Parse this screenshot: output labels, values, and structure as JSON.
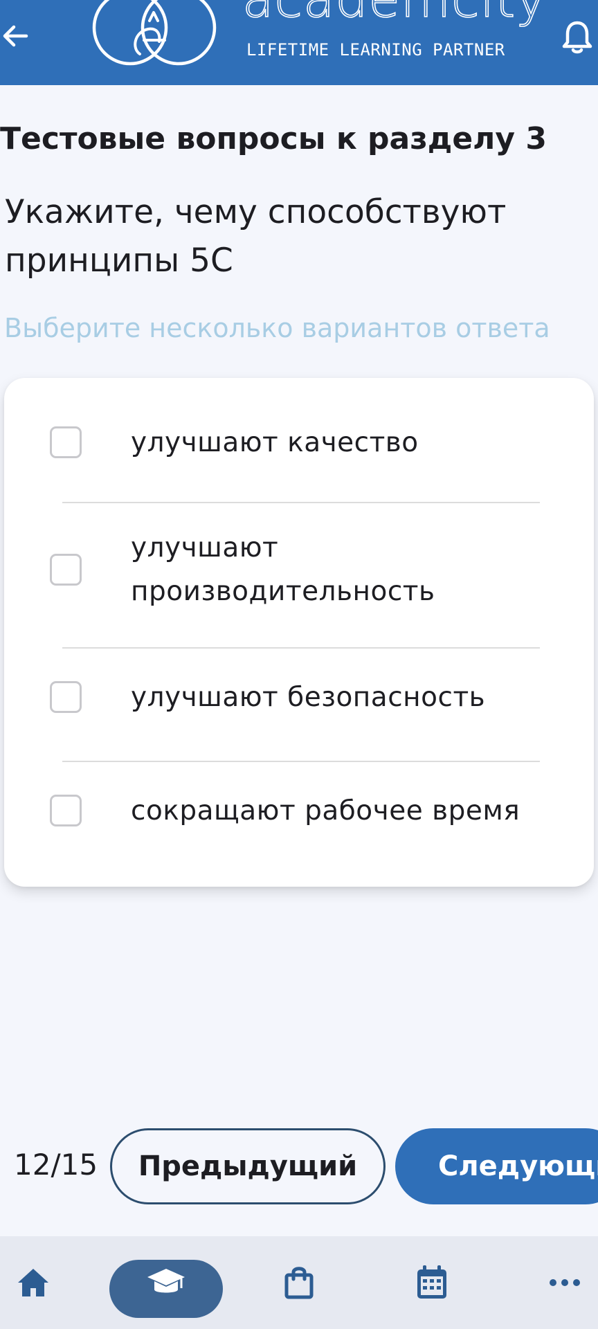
{
  "header": {
    "logo_text": "academcity",
    "tagline": "LIFETIME LEARNING PARTNER"
  },
  "quiz": {
    "section_title": "Тестовые вопросы к разделу 3",
    "question": "Укажите, чему способствуют принципы 5С",
    "hint": "Выберите несколько вариантов ответа",
    "options": [
      {
        "label": "улучшают качество",
        "checked": false
      },
      {
        "label": "улучшают производительность",
        "checked": false
      },
      {
        "label": "улучшают безопасность",
        "checked": false
      },
      {
        "label": "сокращают рабочее время",
        "checked": false
      }
    ]
  },
  "pager": {
    "counter": "12/15",
    "prev_label": "Предыдущий",
    "next_label": "Следующий"
  },
  "tabbar": {
    "items": [
      "home-icon",
      "graduation-cap-icon",
      "shopping-bag-icon",
      "calendar-icon",
      "more-icon"
    ],
    "active": "graduation-cap-icon"
  },
  "colors": {
    "brand": "#2f6fb8",
    "hint": "#a8cde4",
    "tab_active": "#3d6593",
    "background": "#f4f6fc"
  }
}
